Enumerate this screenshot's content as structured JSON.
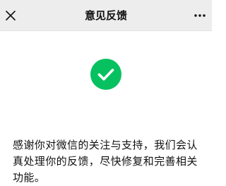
{
  "header": {
    "title": "意见反馈",
    "close_icon": "close-icon",
    "more_icon": "more-icon"
  },
  "main": {
    "status_icon": "check-circle-icon",
    "message": "感谢你对微信的关注与支持，我们会认真处理你的反馈，尽快修复和完善相关功能。"
  },
  "colors": {
    "header_background": "#ededed",
    "success_green": "#07c160",
    "text": "#111111",
    "background": "#ffffff"
  }
}
